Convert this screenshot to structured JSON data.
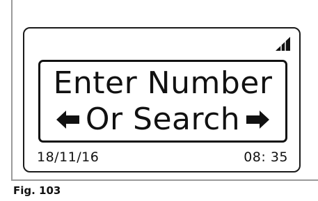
{
  "display": {
    "message_line1": "Enter Number",
    "message_line2": "Or Search",
    "date": "18/11/16",
    "time": "08: 35",
    "left_arrow_icon": "left-arrow-icon",
    "right_arrow_icon": "right-arrow-icon",
    "signal_icon": "signal-strength-icon"
  },
  "caption": {
    "label": "Fig. 103"
  },
  "colors": {
    "ink": "#111111",
    "rule": "#9a9a9a",
    "background": "#ffffff"
  }
}
